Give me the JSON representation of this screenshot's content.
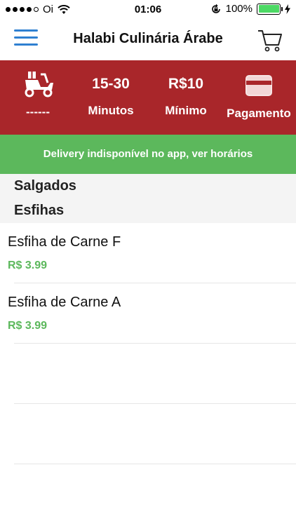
{
  "status_bar": {
    "carrier": "Oi",
    "time": "01:06",
    "battery_percent": "100%",
    "signal_bars_filled": 4,
    "signal_bars_total": 5
  },
  "nav": {
    "title": "Halabi Culinária Árabe",
    "menu_icon": "hamburger-menu-icon",
    "cart_icon": "shopping-cart-icon"
  },
  "info_bar": {
    "delivery_fee": "------",
    "delivery_time_value": "15-30",
    "delivery_time_unit": "Minutos",
    "minimum_value": "R$10",
    "minimum_label": "Mínimo",
    "payment_label": "Pagamento"
  },
  "banner": {
    "text": "Delivery indisponível no app, ver horários"
  },
  "categories": {
    "group": "Salgados",
    "subgroup": "Esfihas"
  },
  "products": [
    {
      "name": "Esfiha de Carne F",
      "price": "R$ 3.99"
    },
    {
      "name": "Esfiha de Carne A",
      "price": "R$ 3.99"
    }
  ],
  "colors": {
    "info_bar_bg": "#a9262a",
    "banner_bg": "#5cb85c",
    "price_green": "#5cb85c",
    "menu_blue": "#2f80d1",
    "battery_green": "#4cd964"
  }
}
